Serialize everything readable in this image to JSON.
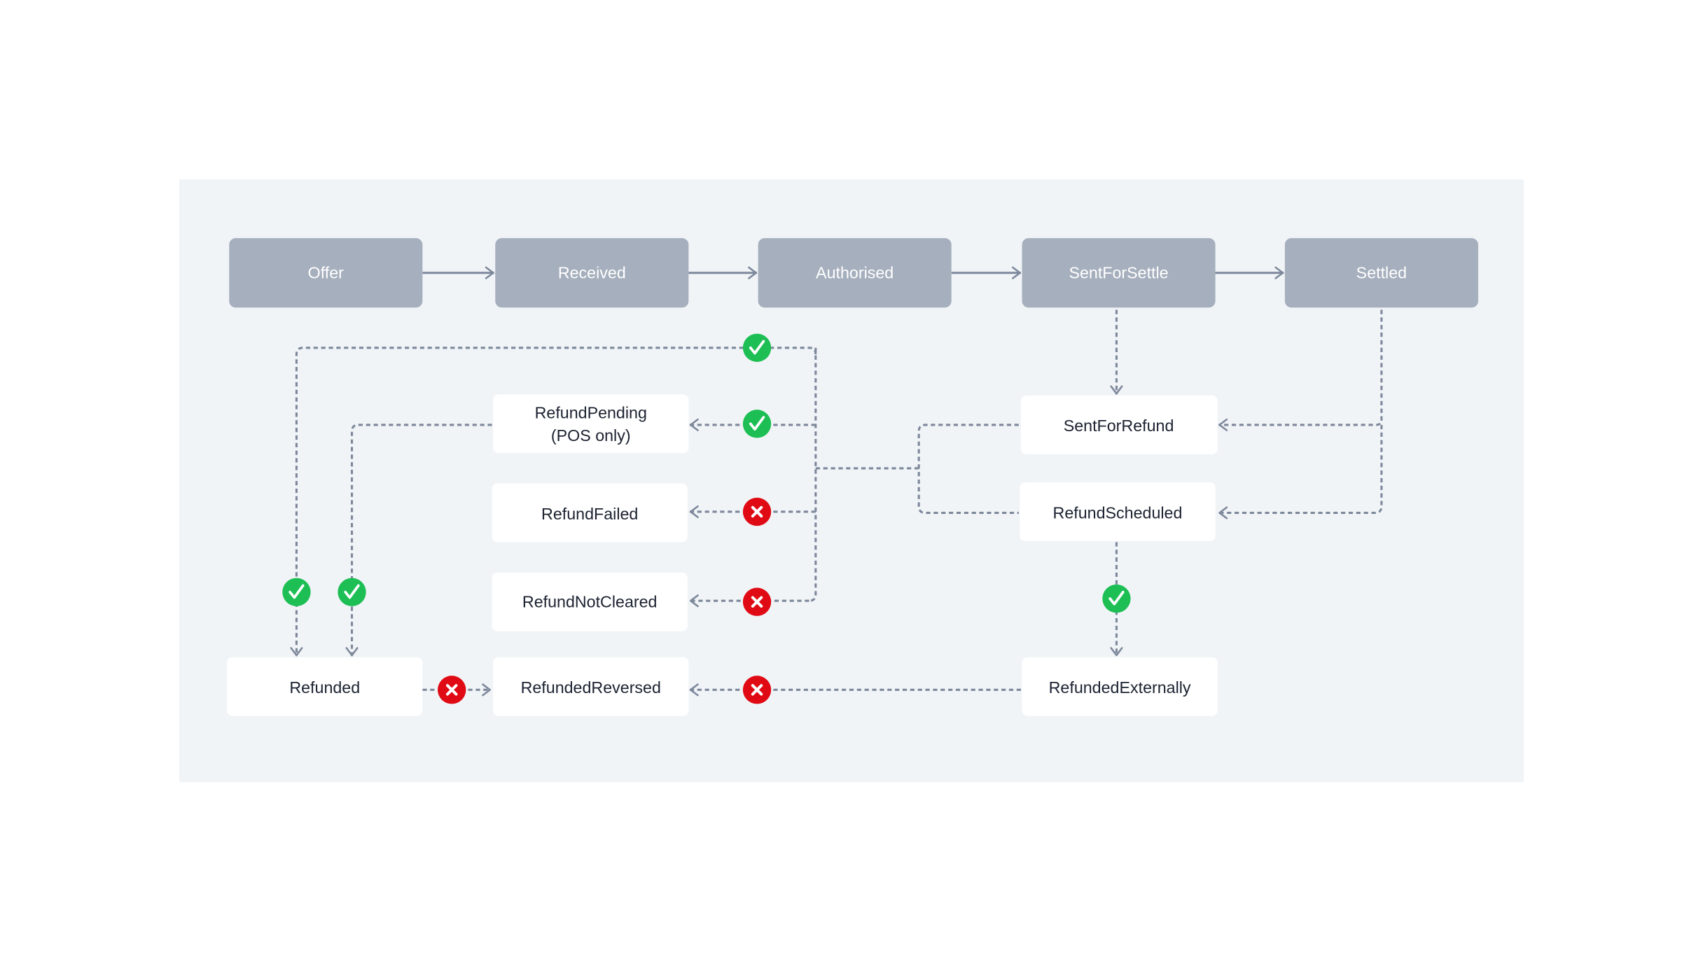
{
  "diagram": {
    "colors": {
      "panel_bg": "#f1f4f7",
      "primary_node_bg": "#a6afbd",
      "primary_node_text": "#ffffff",
      "secondary_node_bg": "#ffffff",
      "secondary_node_text": "#1b2230",
      "connector": "#7d889b",
      "success": "#1dbf55",
      "failure": "#e00a14"
    },
    "nodes": [
      {
        "id": "offer",
        "label": "Offer",
        "kind": "primary"
      },
      {
        "id": "received",
        "label": "Received",
        "kind": "primary"
      },
      {
        "id": "authorised",
        "label": "Authorised",
        "kind": "primary"
      },
      {
        "id": "sentforsettle",
        "label": "SentForSettle",
        "kind": "primary"
      },
      {
        "id": "settled",
        "label": "Settled",
        "kind": "primary"
      },
      {
        "id": "refundpending",
        "label": "RefundPending",
        "label2": "(POS only)",
        "kind": "secondary"
      },
      {
        "id": "refundfailed",
        "label": "RefundFailed",
        "kind": "secondary"
      },
      {
        "id": "refundnotcleared",
        "label": "RefundNotCleared",
        "kind": "secondary"
      },
      {
        "id": "sentforrefund",
        "label": "SentForRefund",
        "kind": "secondary"
      },
      {
        "id": "refundscheduled",
        "label": "RefundScheduled",
        "kind": "secondary"
      },
      {
        "id": "refunded",
        "label": "Refunded",
        "kind": "secondary"
      },
      {
        "id": "refundedreversed",
        "label": "RefundedReversed",
        "kind": "secondary"
      },
      {
        "id": "refundedexternally",
        "label": "RefundedExternally",
        "kind": "secondary"
      }
    ],
    "edges": [
      {
        "from": "offer",
        "to": "received",
        "style": "solid"
      },
      {
        "from": "received",
        "to": "authorised",
        "style": "solid"
      },
      {
        "from": "authorised",
        "to": "sentforsettle",
        "style": "solid"
      },
      {
        "from": "sentforsettle",
        "to": "settled",
        "style": "solid"
      },
      {
        "from": "sentforsettle",
        "to": "sentforrefund",
        "style": "dashed"
      },
      {
        "from": "settled",
        "to": "sentforrefund",
        "style": "dashed"
      },
      {
        "from": "settled",
        "to": "refundscheduled",
        "style": "dashed"
      },
      {
        "from": "sentforrefund",
        "to": "refunded",
        "style": "dashed",
        "status": "success"
      },
      {
        "from": "sentforrefund",
        "to": "refundpending",
        "style": "dashed",
        "status": "success"
      },
      {
        "from": "sentforrefund",
        "to": "refundfailed",
        "style": "dashed",
        "status": "failure"
      },
      {
        "from": "sentforrefund",
        "to": "refundnotcleared",
        "style": "dashed",
        "status": "failure"
      },
      {
        "from": "refundscheduled",
        "to": "refundpending",
        "style": "dashed"
      },
      {
        "from": "refundpending",
        "to": "refunded",
        "style": "dashed",
        "status": "success"
      },
      {
        "from": "refundscheduled",
        "to": "refundedexternally",
        "style": "dashed",
        "status": "success"
      },
      {
        "from": "refunded",
        "to": "refundedreversed",
        "style": "dashed",
        "status": "failure"
      },
      {
        "from": "refundedexternally",
        "to": "refundedreversed",
        "style": "dashed",
        "status": "failure"
      }
    ],
    "status_icons": {
      "success": "check-icon",
      "failure": "cross-icon"
    }
  }
}
